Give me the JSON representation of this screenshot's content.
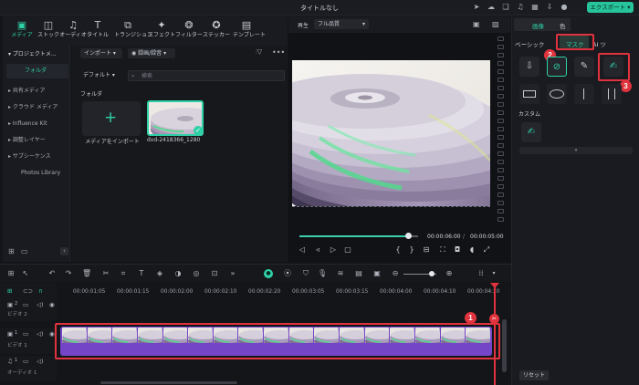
{
  "window": {
    "title": "タイトルなし",
    "export_label": "エクスポート"
  },
  "media_tabs": [
    {
      "label": "メディア",
      "icon": "media-folder-icon",
      "active": true
    },
    {
      "label": "ストック",
      "icon": "stock-icon"
    },
    {
      "label": "オーディオ",
      "icon": "music-note-icon"
    },
    {
      "label": "タイトル",
      "icon": "text-T-icon"
    },
    {
      "label": "トランジション",
      "icon": "transition-icon"
    },
    {
      "label": "エフェクト",
      "icon": "effect-sparkle-icon"
    },
    {
      "label": "フィルター",
      "icon": "filter-icon"
    },
    {
      "label": "ステッカー",
      "icon": "sticker-icon"
    },
    {
      "label": "テンプレート",
      "icon": "template-icon"
    }
  ],
  "left_nav": {
    "project": "プロジェクトメ...",
    "folder": "フォルダ",
    "items": [
      "共有メディア",
      "クラウド メディア",
      "Influence Kit",
      "調整レイヤー",
      "サブシーケンス",
      "Photos Library"
    ]
  },
  "media": {
    "import_label": "インポート",
    "sort_label": "録画/録音",
    "view_label": "デフォルト",
    "search_placeholder": "検索",
    "folder_heading": "フォルダ",
    "import_tile_label": "メディアをインポート",
    "clip_name": "dvd-2418366_1280"
  },
  "player": {
    "label": "再生",
    "quality": "フル品質",
    "current_time": "00:00:06:00",
    "separator": "/",
    "total_time": "00:00:05:00"
  },
  "right_panel": {
    "tabs": [
      "画像",
      "色"
    ],
    "subtabs": [
      "ベーシック",
      "マスク",
      "AI ツ"
    ],
    "custom_label": "カスタム",
    "reset_label": "リセット"
  },
  "timeline": {
    "timecodes": [
      "00:00:01:05",
      "00:00:01:15",
      "00:00:02:00",
      "00:00:02:10",
      "00:00:02:20",
      "00:00:03:05",
      "00:00:03:15",
      "00:00:04:00",
      "00:00:04:10",
      "00:00:04:20"
    ],
    "tracks": [
      {
        "name": "ビデオ 2",
        "num": "2"
      },
      {
        "name": "ビデオ 1",
        "num": "1"
      },
      {
        "name": "オーディオ 1",
        "num": "1"
      }
    ]
  },
  "annotations": [
    "1",
    "2",
    "3"
  ],
  "colors": {
    "accent": "#2fd1a7",
    "highlight": "#e0333d",
    "clip": "#7446c7"
  }
}
